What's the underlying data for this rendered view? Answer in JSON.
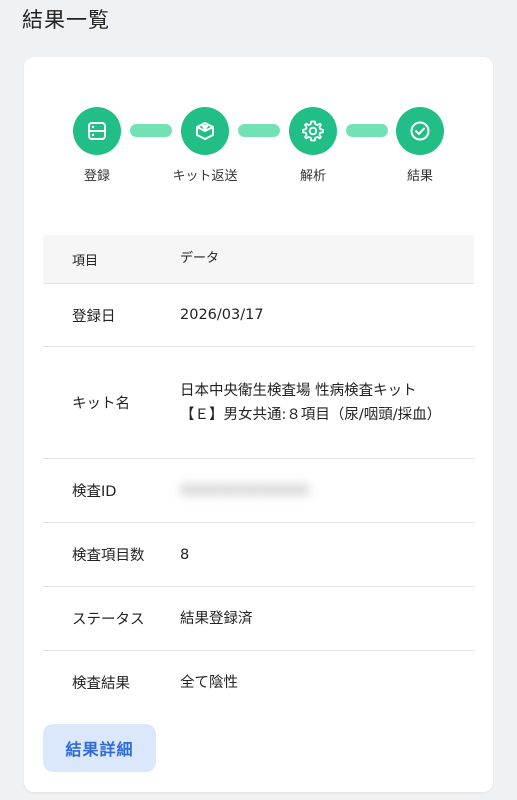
{
  "page": {
    "title": "結果一覧"
  },
  "stepper": {
    "steps": [
      {
        "label": "登録",
        "icon": "server-icon"
      },
      {
        "label": "キット返送",
        "icon": "box-icon"
      },
      {
        "label": "解析",
        "icon": "gear-icon"
      },
      {
        "label": "結果",
        "icon": "check-circle-icon"
      }
    ],
    "active_color": "#21bf86",
    "connector_color": "#72e2b5"
  },
  "table": {
    "headers": {
      "key": "項目",
      "value": "データ"
    },
    "rows": [
      {
        "key": "登録日",
        "value": "2026/03/17"
      },
      {
        "key": "キット名",
        "value": "日本中央衛生検査場 性病検査キット【Ｅ】男女共通:８項目（尿/咽頭/採血）"
      },
      {
        "key": "検査ID",
        "value": "XXXXXXXXXXXXX"
      },
      {
        "key": "検査項目数",
        "value": "8"
      },
      {
        "key": "ステータス",
        "value": "結果登録済"
      },
      {
        "key": "検査結果",
        "value": "全て陰性"
      }
    ]
  },
  "actions": {
    "detail_label": "結果詳細"
  }
}
